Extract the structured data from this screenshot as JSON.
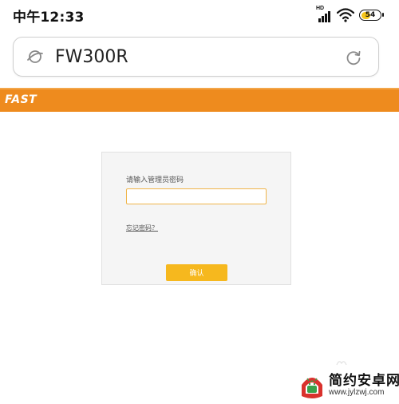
{
  "status_bar": {
    "time": "中午12:33",
    "network_label": "HD",
    "battery_level": "54",
    "battery_fraction": 0.54,
    "icons": [
      "signal-icon",
      "wifi-icon",
      "battery-icon"
    ]
  },
  "address_bar": {
    "url": "FW300R",
    "left_icon": "planet-icon",
    "right_icon": "refresh-icon"
  },
  "brand_bar": {
    "logo_text": "FAST",
    "color": "#ee8b1e"
  },
  "login": {
    "label": "请输入管理员密码",
    "password_value": "",
    "forgot_link": "忘记密码？",
    "confirm_button": "确认",
    "accent_color": "#f6b81e"
  },
  "watermark": {
    "text": "简约安卓网",
    "url": "www.jylzwj.com"
  }
}
